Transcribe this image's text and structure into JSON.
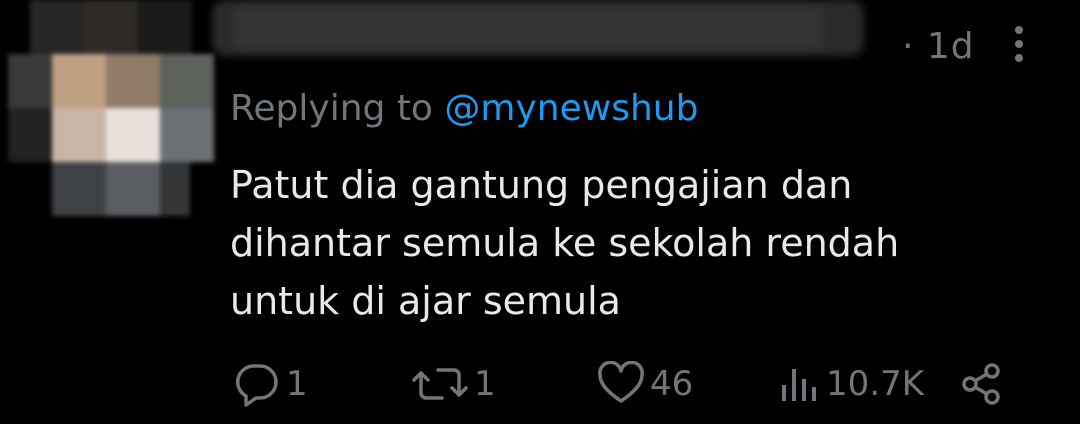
{
  "tweet": {
    "time": "· 1d",
    "reply_prefix": "Replying to",
    "reply_handle": "@mynewshub",
    "text": "Patut dia gantung pengajian dan dihantar semula ke sekolah rendah untuk di ajar semula",
    "colors": {
      "background": "#000000",
      "text": "#e7e9ea",
      "muted": "#71767b",
      "link": "#1d9bf0"
    }
  },
  "actions": {
    "reply": {
      "icon": "reply-icon",
      "count": "1"
    },
    "retweet": {
      "icon": "retweet-icon",
      "count": "1"
    },
    "like": {
      "icon": "heart-icon",
      "count": "46"
    },
    "views": {
      "icon": "views-icon",
      "count": "10.7K"
    },
    "share": {
      "icon": "share-icon"
    }
  }
}
